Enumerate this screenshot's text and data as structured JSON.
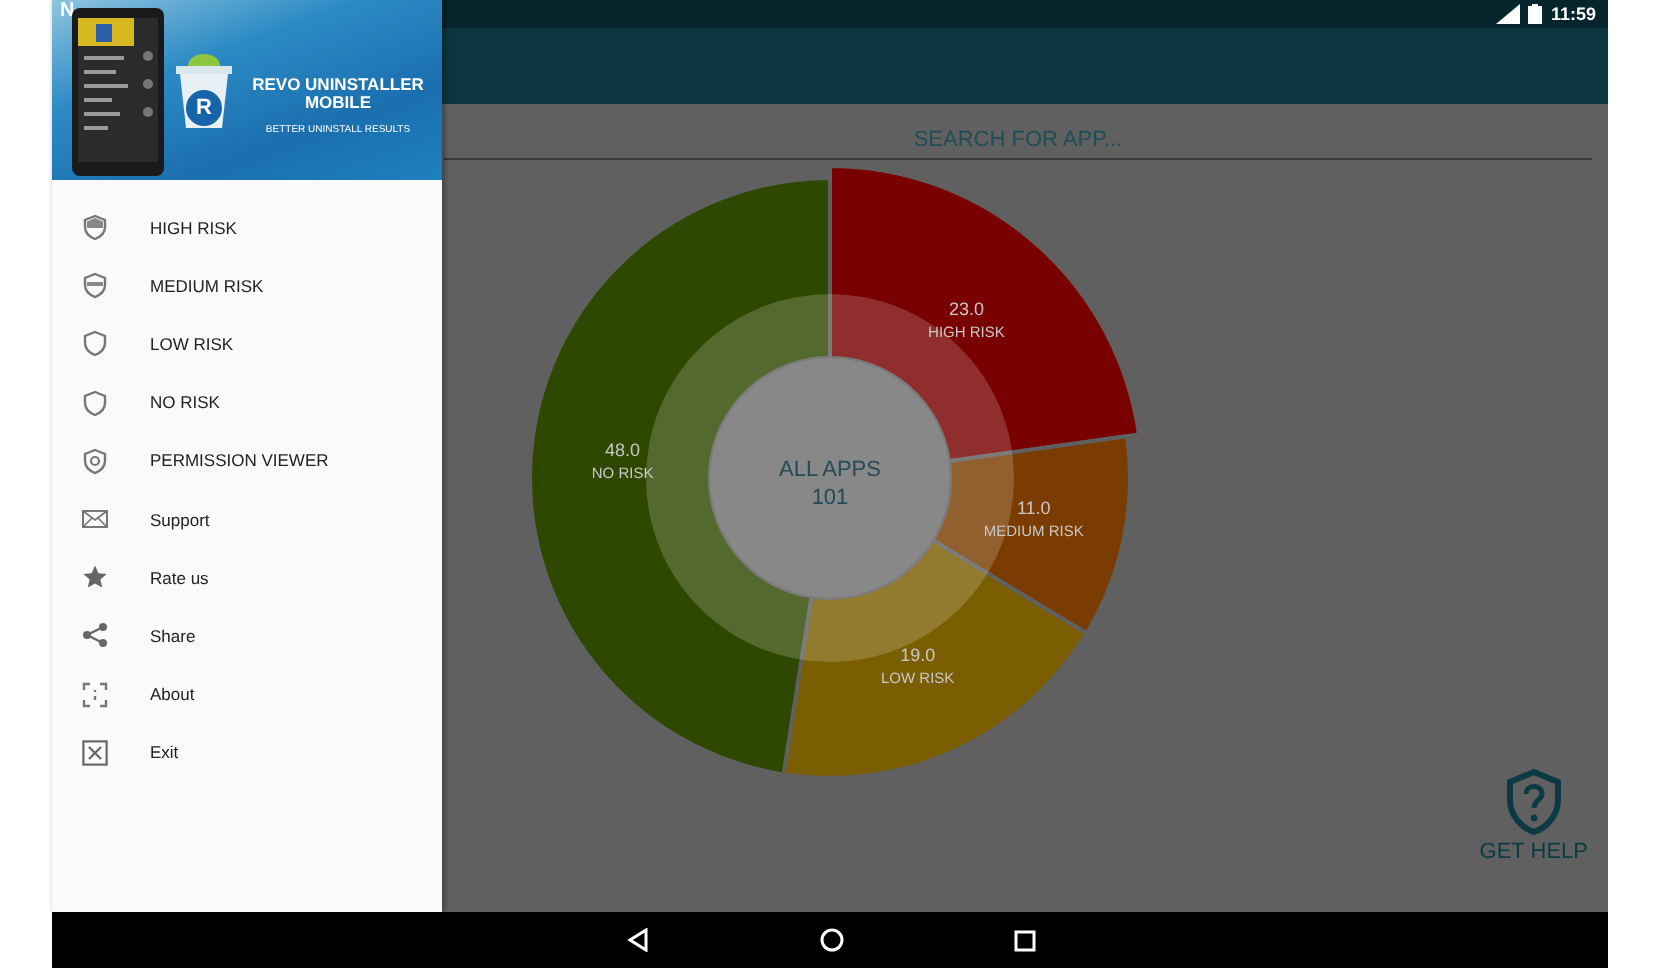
{
  "status_bar": {
    "notification": "N",
    "time": "11:59"
  },
  "drawer": {
    "header": {
      "logo_letter": "R",
      "title": "REVO UNINSTALLER MOBILE",
      "subtitle": "BETTER UNINSTALL RESULTS"
    },
    "items": [
      {
        "label": "HIGH RISK",
        "kind": "shield-high"
      },
      {
        "label": "MEDIUM RISK",
        "kind": "shield-medium"
      },
      {
        "label": "LOW RISK",
        "kind": "shield"
      },
      {
        "label": "NO RISK",
        "kind": "shield"
      },
      {
        "label": "PERMISSION VIEWER",
        "kind": "shield-eye"
      },
      {
        "label": "Support",
        "kind": "mail"
      },
      {
        "label": "Rate us",
        "kind": "star"
      },
      {
        "label": "Share",
        "kind": "share"
      },
      {
        "label": "About",
        "kind": "about"
      },
      {
        "label": "Exit",
        "kind": "exit"
      }
    ]
  },
  "search": {
    "placeholder": "SEARCH FOR APP..."
  },
  "summary": {
    "chart_data": {
      "type": "donut",
      "categories": [
        "HIGH RISK",
        "MEDIUM RISK",
        "LOW RISK",
        "NO RISK"
      ],
      "values": [
        23,
        11,
        19,
        48
      ],
      "value_labels": [
        "23.0",
        "11.0",
        "19.0",
        "48.0"
      ],
      "data_labels": true
    },
    "center_label": "ALL APPS",
    "center_count": "101"
  },
  "help_button": {
    "label": "GET HELP"
  }
}
